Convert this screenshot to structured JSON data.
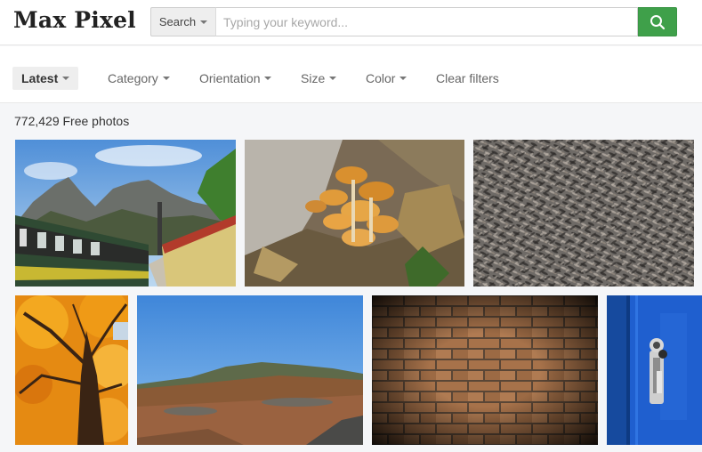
{
  "header": {
    "logo": "Max Pixel",
    "search": {
      "type_label": "Search",
      "placeholder": "Typing your keyword..."
    }
  },
  "filters": {
    "latest": "Latest",
    "category": "Category",
    "orientation": "Orientation",
    "size": "Size",
    "color": "Color",
    "clear": "Clear filters"
  },
  "results": {
    "count_text": "772,429 Free photos"
  },
  "photos": [
    {
      "subject": "green train at mountain station"
    },
    {
      "subject": "orange mushrooms among leaves"
    },
    {
      "subject": "pile of sunflower seeds"
    },
    {
      "subject": "orange autumn tree from below"
    },
    {
      "subject": "dry grass hillside under blue sky"
    },
    {
      "subject": "brick wall with vignette"
    },
    {
      "subject": "blue door with lock"
    }
  ],
  "colors": {
    "accent": "#3fa04a"
  }
}
